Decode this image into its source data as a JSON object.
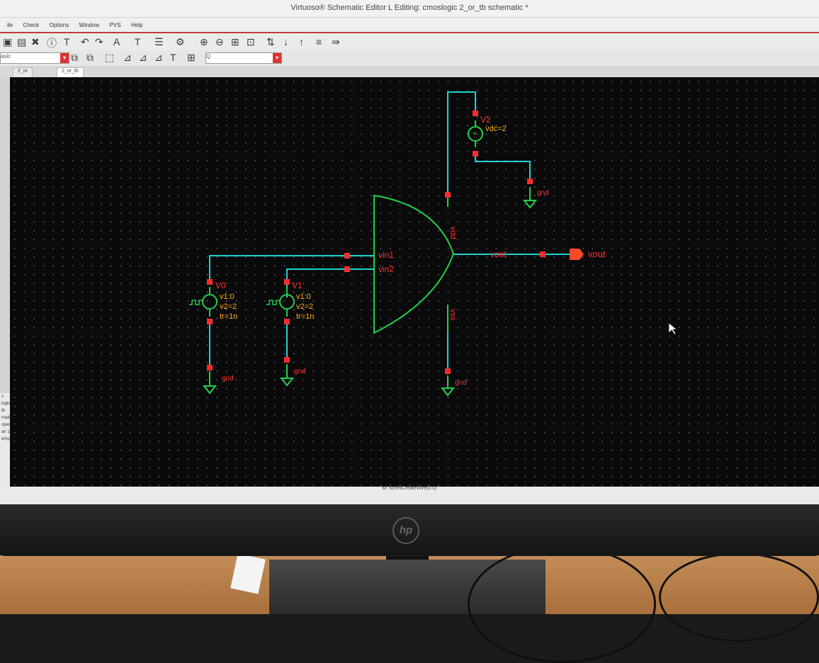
{
  "window": {
    "title": "Virtuoso® Schematic Editor L Editing: cmoslogic 2_or_tb schematic *"
  },
  "menu": {
    "items": [
      "ile",
      "Check",
      "Options",
      "Window",
      "PVS",
      "Help"
    ]
  },
  "toolbar": {
    "left_combo": "asic",
    "search_placeholder": "Q"
  },
  "tabs": [
    {
      "label": "2_or"
    },
    {
      "label": "2_or_tb"
    }
  ],
  "left_panel": {
    "combo": "s",
    "items": [
      "logic",
      "tb",
      "matic",
      "open",
      "an 1...",
      "empty..."
    ]
  },
  "status": {
    "text": "M: schHiCreateWire(0.0)"
  },
  "schematic": {
    "gate": {
      "pin_in1": "vin1",
      "pin_in2": "vin2",
      "pin_vdd": "vdd",
      "pin_vss": "vss"
    },
    "net_out": "vout",
    "out_pin": "vout",
    "v0": {
      "name": "V0",
      "p1": "v1:0",
      "p2": "v2=2",
      "p3": "tr=1n"
    },
    "v1": {
      "name": "V1",
      "p1": "v1:0",
      "p2": "v2=2",
      "p3": "tr=1n"
    },
    "v2": {
      "name": "V2",
      "p1": "vdc=2"
    },
    "gnd": "gnd"
  },
  "monitor": {
    "brand": "hp"
  },
  "colors": {
    "wire": "#22d3d0",
    "symbol": "#22d04a",
    "pin": "#ff2b2b",
    "label_red": "#ff3030",
    "label_orange": "#ffb020",
    "canvas_bg": "#0a0a0a"
  }
}
